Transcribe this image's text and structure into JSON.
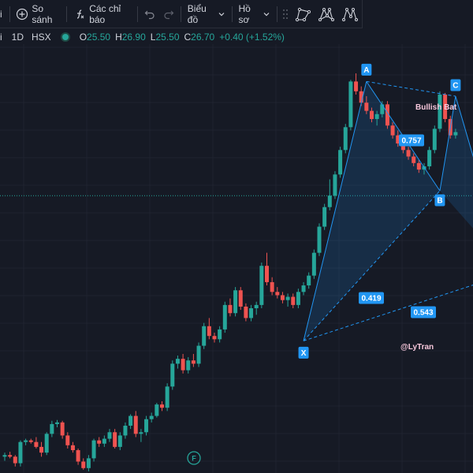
{
  "toolbar": {
    "symbol_partial": "i",
    "compare_label": "So sánh",
    "indicators_label": "Các chỉ báo",
    "chart_label": "Biểu đồ",
    "profile_label": "Hồ sơ"
  },
  "legend": {
    "interval_partial": "i",
    "interval": "1D",
    "exchange": "HSX",
    "o_label": "O",
    "o_val": "25.50",
    "h_label": "H",
    "h_val": "26.90",
    "l_label": "L",
    "l_val": "25.50",
    "c_label": "C",
    "c_val": "26.70",
    "change": "+0.40 (+1.52%)"
  },
  "colors": {
    "background": "#161a25",
    "up": "#26a69a",
    "down": "#ef5350",
    "pattern_line": "#2196f3",
    "label_bg": "#2196f3",
    "pattern_title": "#f8c8dc"
  },
  "icons": [
    "plus-circle-icon",
    "fx-icon",
    "undo-icon",
    "redo-icon",
    "chevron-down-icon",
    "drag-handle-icon",
    "vertex-shape-icon",
    "vertex-triangle-icon",
    "vertex-zigzag-icon",
    "event-flag-icon"
  ],
  "chart_data": {
    "type": "candlestick",
    "price_range": [
      23.3,
      28.5
    ],
    "last_price_line": 26.7,
    "candles": [
      [
        23.5,
        23.55,
        23.45,
        23.52
      ],
      [
        23.52,
        23.56,
        23.48,
        23.5
      ],
      [
        23.5,
        23.52,
        23.38,
        23.42
      ],
      [
        23.42,
        23.7,
        23.38,
        23.68
      ],
      [
        23.68,
        23.72,
        23.64,
        23.7
      ],
      [
        23.7,
        23.72,
        23.66,
        23.68
      ],
      [
        23.68,
        23.74,
        23.6,
        23.62
      ],
      [
        23.62,
        23.68,
        23.5,
        23.55
      ],
      [
        23.55,
        23.8,
        23.52,
        23.78
      ],
      [
        23.78,
        23.94,
        23.74,
        23.9
      ],
      [
        23.9,
        23.95,
        23.86,
        23.92
      ],
      [
        23.92,
        23.94,
        23.72,
        23.76
      ],
      [
        23.76,
        23.8,
        23.6,
        23.64
      ],
      [
        23.64,
        23.68,
        23.55,
        23.58
      ],
      [
        23.58,
        23.6,
        23.4,
        23.44
      ],
      [
        23.44,
        23.48,
        23.34,
        23.36
      ],
      [
        23.36,
        23.52,
        23.32,
        23.48
      ],
      [
        23.48,
        23.72,
        23.44,
        23.7
      ],
      [
        23.7,
        23.74,
        23.62,
        23.66
      ],
      [
        23.66,
        23.76,
        23.62,
        23.72
      ],
      [
        23.72,
        23.84,
        23.68,
        23.8
      ],
      [
        23.8,
        23.84,
        23.6,
        23.62
      ],
      [
        23.62,
        23.8,
        23.58,
        23.76
      ],
      [
        23.76,
        23.92,
        23.72,
        23.88
      ],
      [
        23.88,
        24.02,
        23.84,
        24.0
      ],
      [
        24.0,
        24.06,
        23.74,
        23.78
      ],
      [
        23.78,
        23.84,
        23.68,
        23.8
      ],
      [
        23.8,
        24.0,
        23.76,
        23.96
      ],
      [
        23.96,
        24.04,
        23.92,
        24.0
      ],
      [
        24.0,
        24.16,
        23.98,
        24.14
      ],
      [
        24.14,
        24.18,
        24.06,
        24.1
      ],
      [
        24.1,
        24.4,
        24.06,
        24.36
      ],
      [
        24.36,
        24.68,
        24.32,
        24.64
      ],
      [
        24.64,
        24.74,
        24.58,
        24.7
      ],
      [
        24.7,
        24.76,
        24.52,
        24.56
      ],
      [
        24.56,
        24.72,
        24.52,
        24.68
      ],
      [
        24.68,
        24.76,
        24.6,
        24.64
      ],
      [
        24.64,
        24.9,
        24.6,
        24.86
      ],
      [
        24.86,
        25.14,
        24.82,
        25.1
      ],
      [
        25.1,
        25.2,
        24.94,
        24.98
      ],
      [
        24.98,
        25.02,
        24.9,
        24.94
      ],
      [
        24.94,
        25.1,
        24.9,
        25.06
      ],
      [
        25.06,
        25.4,
        25.02,
        25.36
      ],
      [
        25.36,
        25.44,
        25.22,
        25.26
      ],
      [
        25.26,
        25.58,
        25.22,
        25.54
      ],
      [
        25.54,
        25.58,
        25.3,
        25.34
      ],
      [
        25.34,
        25.38,
        25.16,
        25.2
      ],
      [
        25.2,
        25.36,
        25.16,
        25.32
      ],
      [
        25.32,
        25.4,
        25.24,
        25.36
      ],
      [
        25.36,
        25.88,
        25.32,
        25.84
      ],
      [
        25.84,
        26.0,
        25.6,
        25.64
      ],
      [
        25.64,
        25.7,
        25.48,
        25.52
      ],
      [
        25.52,
        25.58,
        25.44,
        25.48
      ],
      [
        25.48,
        25.52,
        25.38,
        25.42
      ],
      [
        25.42,
        25.5,
        25.34,
        25.46
      ],
      [
        25.46,
        25.5,
        25.32,
        25.36
      ],
      [
        25.36,
        25.56,
        25.32,
        25.52
      ],
      [
        25.52,
        25.64,
        25.48,
        25.6
      ],
      [
        25.6,
        25.76,
        25.56,
        25.72
      ],
      [
        25.72,
        26.04,
        25.68,
        26.0
      ],
      [
        26.0,
        26.36,
        25.96,
        26.32
      ],
      [
        26.32,
        26.6,
        26.28,
        26.56
      ],
      [
        26.56,
        26.9,
        26.52,
        26.7
      ],
      [
        26.7,
        27.0,
        26.66,
        26.96
      ],
      [
        26.96,
        27.3,
        26.92,
        27.26
      ],
      [
        27.26,
        27.58,
        27.22,
        27.54
      ],
      [
        27.54,
        28.12,
        27.5,
        28.1
      ],
      [
        28.1,
        28.2,
        27.94,
        27.98
      ],
      [
        27.98,
        28.04,
        27.8,
        27.84
      ],
      [
        27.84,
        27.92,
        27.7,
        27.74
      ],
      [
        27.74,
        27.78,
        27.6,
        27.64
      ],
      [
        27.64,
        27.74,
        27.56,
        27.7
      ],
      [
        27.7,
        27.86,
        27.66,
        27.82
      ],
      [
        27.82,
        27.86,
        27.52,
        27.56
      ],
      [
        27.56,
        27.6,
        27.4,
        27.44
      ],
      [
        27.44,
        27.5,
        27.3,
        27.34
      ],
      [
        27.34,
        27.4,
        27.22,
        27.26
      ],
      [
        27.26,
        27.3,
        27.14,
        27.18
      ],
      [
        27.18,
        27.22,
        27.06,
        27.1
      ],
      [
        27.1,
        27.14,
        26.98,
        27.02
      ],
      [
        27.02,
        27.1,
        26.96,
        27.06
      ],
      [
        27.06,
        27.3,
        27.02,
        27.26
      ],
      [
        27.26,
        27.56,
        27.22,
        27.52
      ],
      [
        27.52,
        27.98,
        27.48,
        27.94
      ],
      [
        27.94,
        27.96,
        27.6,
        27.64
      ],
      [
        27.64,
        27.68,
        27.4,
        27.44
      ],
      [
        27.44,
        27.52,
        27.4,
        27.48
      ]
    ],
    "pattern": {
      "name": "Bullish Bat",
      "points": [
        {
          "label": "X",
          "price": 24.92
        },
        {
          "label": "A",
          "price": 28.1
        },
        {
          "label": "B",
          "price": 26.76
        },
        {
          "label": "C",
          "price": 27.92
        }
      ],
      "ratios": [
        {
          "label": "0.757"
        },
        {
          "label": "0.419"
        },
        {
          "label": "0.543"
        }
      ]
    },
    "watermark": "@LyTran",
    "event_flag": "F"
  }
}
